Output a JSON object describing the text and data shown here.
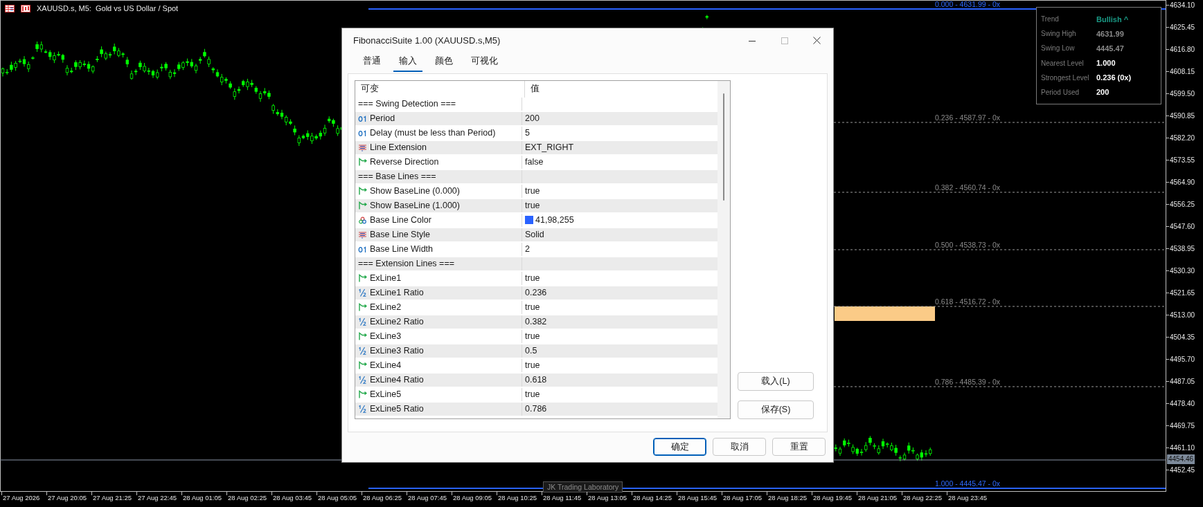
{
  "chart_header": {
    "title": "XAUUSD.s, M5:  Gold vs US Dollar / Spot"
  },
  "fib_levels": [
    {
      "label": "0.000 - 4631.99 - 0x",
      "kind": "solid"
    },
    {
      "label": "0.236 - 4587.97 - 0x",
      "kind": "dashed"
    },
    {
      "label": "0.382 - 4560.74 - 0x",
      "kind": "dashed"
    },
    {
      "label": "0.500 - 4538.73 - 0x",
      "kind": "dashed"
    },
    {
      "label": "0.618 - 4516.72 - 0x",
      "kind": "dashed"
    },
    {
      "label": "0.786 - 4485.39 - 0x",
      "kind": "dashed"
    },
    {
      "label": "1.000 - 4445.47 - 0x",
      "kind": "solid"
    }
  ],
  "chart_label": "JK Trading Laboratory",
  "info_panel": {
    "rows": [
      {
        "label": "Trend",
        "value": "Bullish ^",
        "color": "#1a9a86"
      },
      {
        "label": "Swing High",
        "value": "4631.99",
        "color": "#8a8a8a"
      },
      {
        "label": "Swing Low",
        "value": "4445.47",
        "color": "#8a8a8a"
      },
      {
        "label": "Nearest Level",
        "value": "1.000",
        "color": "#ffffff"
      },
      {
        "label": "Strongest Level",
        "value": "0.236 (0x)",
        "color": "#ffffff"
      },
      {
        "label": "Period Used",
        "value": "200",
        "color": "#ffffff"
      }
    ]
  },
  "price_axis": {
    "labels": [
      "4634.10",
      "4625.45",
      "4616.80",
      "4608.15",
      "4599.50",
      "4590.85",
      "4582.20",
      "4573.55",
      "4564.90",
      "4556.25",
      "4547.60",
      "4538.95",
      "4530.30",
      "4521.65",
      "4513.00",
      "4504.35",
      "4495.70",
      "4487.05",
      "4478.40",
      "4469.75",
      "4461.10",
      "4452.45"
    ],
    "current_price": "4454.46"
  },
  "time_axis": {
    "labels": [
      "27 Aug 2026",
      "27 Aug 20:05",
      "27 Aug 21:25",
      "27 Aug 22:45",
      "28 Aug 01:05",
      "28 Aug 02:25",
      "28 Aug 03:45",
      "28 Aug 05:05",
      "28 Aug 06:25",
      "28 Aug 07:45",
      "28 Aug 09:05",
      "28 Aug 10:25",
      "28 Aug 11:45",
      "28 Aug 13:05",
      "28 Aug 14:25",
      "28 Aug 15:45",
      "28 Aug 17:05",
      "28 Aug 18:25",
      "28 Aug 19:45",
      "28 Aug 21:05",
      "28 Aug 22:25",
      "28 Aug 23:45"
    ]
  },
  "dialog": {
    "title": "FibonacciSuite 1.00 (XAUUSD.s,M5)",
    "tabs": [
      {
        "label": "普通",
        "selected": false
      },
      {
        "label": "输入",
        "selected": true
      },
      {
        "label": "颜色",
        "selected": false
      },
      {
        "label": "可视化",
        "selected": false
      }
    ],
    "table": {
      "columns": [
        "可变",
        "值"
      ],
      "rows": [
        {
          "kind": "section",
          "name": "=== Swing Detection ==="
        },
        {
          "kind": "int",
          "name": "Period",
          "value": "200"
        },
        {
          "kind": "int",
          "name": "Delay (must be less than Period)",
          "value": "5"
        },
        {
          "kind": "enum",
          "name": "Line Extension",
          "value": "EXT_RIGHT"
        },
        {
          "kind": "bool",
          "name": "Reverse Direction",
          "value": "false"
        },
        {
          "kind": "section",
          "name": "=== Base Lines ==="
        },
        {
          "kind": "bool",
          "name": "Show BaseLine (0.000)",
          "value": "true"
        },
        {
          "kind": "bool",
          "name": "Show BaseLine (1.000)",
          "value": "true"
        },
        {
          "kind": "color",
          "name": "Base Line Color",
          "value": "41,98,255",
          "color": "#2962ff"
        },
        {
          "kind": "enum",
          "name": "Base Line Style",
          "value": "Solid"
        },
        {
          "kind": "int",
          "name": "Base Line Width",
          "value": "2"
        },
        {
          "kind": "section",
          "name": "=== Extension Lines ==="
        },
        {
          "kind": "bool",
          "name": "ExLine1",
          "value": "true"
        },
        {
          "kind": "double",
          "name": "ExLine1 Ratio",
          "value": "0.236"
        },
        {
          "kind": "bool",
          "name": "ExLine2",
          "value": "true"
        },
        {
          "kind": "double",
          "name": "ExLine2 Ratio",
          "value": "0.382"
        },
        {
          "kind": "bool",
          "name": "ExLine3",
          "value": "true"
        },
        {
          "kind": "double",
          "name": "ExLine3 Ratio",
          "value": "0.5"
        },
        {
          "kind": "bool",
          "name": "ExLine4",
          "value": "true"
        },
        {
          "kind": "double",
          "name": "ExLine4 Ratio",
          "value": "0.618"
        },
        {
          "kind": "bool",
          "name": "ExLine5",
          "value": "true"
        },
        {
          "kind": "double",
          "name": "ExLine5 Ratio",
          "value": "0.786"
        }
      ]
    },
    "side_buttons": [
      "载入(L)",
      "保存(S)"
    ],
    "buttons": [
      {
        "label": "确定",
        "default": true
      },
      {
        "label": "取消",
        "default": false
      },
      {
        "label": "重置",
        "default": false
      }
    ]
  }
}
